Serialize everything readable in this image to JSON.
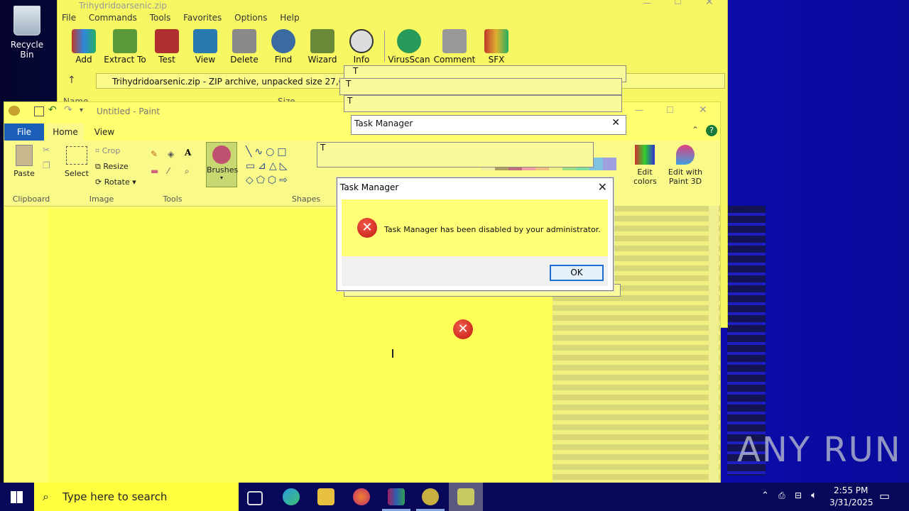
{
  "desktop": {
    "recycle_bin_label": "Recycle Bin"
  },
  "winrar": {
    "title": "Trihydridoarsenic.zip",
    "menu": [
      "File",
      "Commands",
      "Tools",
      "Favorites",
      "Options",
      "Help"
    ],
    "toolbar": [
      "Add",
      "Extract To",
      "Test",
      "View",
      "Delete",
      "Find",
      "Wizard",
      "Info",
      "VirusScan",
      "Comment",
      "SFX"
    ],
    "address": "Trihydridoarsenic.zip - ZIP archive, unpacked size 27,648 bytes",
    "col_name": "Name",
    "col_size": "Size"
  },
  "paint": {
    "title": "Untitled - Paint",
    "tabs": {
      "file": "File",
      "home": "Home",
      "view": "View"
    },
    "ribbon": {
      "paste": "Paste",
      "clipboard": "Clipboard",
      "select": "Select",
      "crop": "Crop",
      "resize": "Resize",
      "rotate": "Rotate",
      "image": "Image",
      "tools": "Tools",
      "brushes": "Brushes",
      "shapes": "Shapes",
      "edit_colors": "Edit colors",
      "edit_paint3d": "Edit with Paint 3D"
    }
  },
  "ghost_dialogs": {
    "title": "Task Manager",
    "title_partial": "T"
  },
  "dialog": {
    "title": "Task Manager",
    "message": "Task Manager has been disabled by your administrator.",
    "ok": "OK"
  },
  "taskbar": {
    "search_placeholder": "Type here to search",
    "time": "2:55 PM",
    "date": "3/31/2025"
  },
  "watermark": "ANY RUN",
  "colors": {
    "accent": "#1c5fb8",
    "error": "#d32416",
    "overlay_yellow": "#ffff70"
  }
}
